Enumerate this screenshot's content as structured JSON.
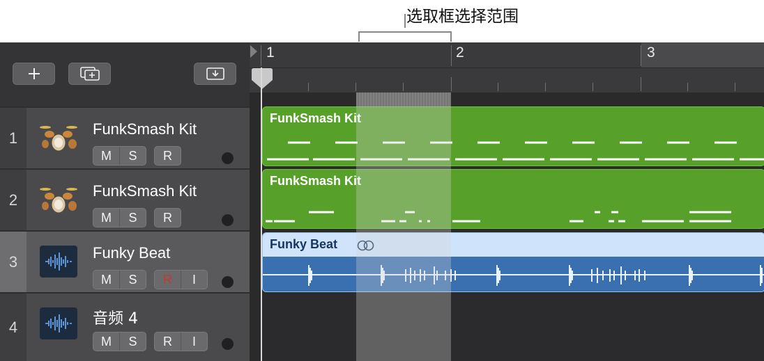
{
  "callout": {
    "label": "选取框选择范围"
  },
  "toolbar": {
    "add_icon": "plus-icon",
    "add_track_icon": "duplicate-plus-icon",
    "import_icon": "download-tray-icon"
  },
  "ruler": {
    "bars": [
      "1",
      "2",
      "3"
    ]
  },
  "tracks": [
    {
      "number": "1",
      "name": "FunkSmash Kit",
      "buttons": [
        "M",
        "S",
        "R"
      ],
      "icon": "drum-kit-icon"
    },
    {
      "number": "2",
      "name": "FunkSmash Kit",
      "buttons": [
        "M",
        "S",
        "R"
      ],
      "icon": "drum-kit-icon"
    },
    {
      "number": "3",
      "name": "Funky Beat",
      "buttons": [
        "M",
        "S",
        "R",
        "I"
      ],
      "icon": "audio-waveform-icon"
    },
    {
      "number": "4",
      "name": "音频 4",
      "buttons": [
        "M",
        "S",
        "R",
        "I"
      ],
      "icon": "audio-waveform-icon"
    }
  ],
  "regions": [
    {
      "name": "FunkSmash Kit",
      "color": "#57a02a"
    },
    {
      "name": "FunkSmash Kit",
      "color": "#57a02a"
    },
    {
      "name": "Funky Beat",
      "color": "#3a6fb0"
    }
  ],
  "colors": {
    "drummer_region": "#57a02a",
    "audio_region_header": "#cfe3fb",
    "audio_region_body": "#3a6fb0",
    "record_armed": "#c23a30"
  }
}
